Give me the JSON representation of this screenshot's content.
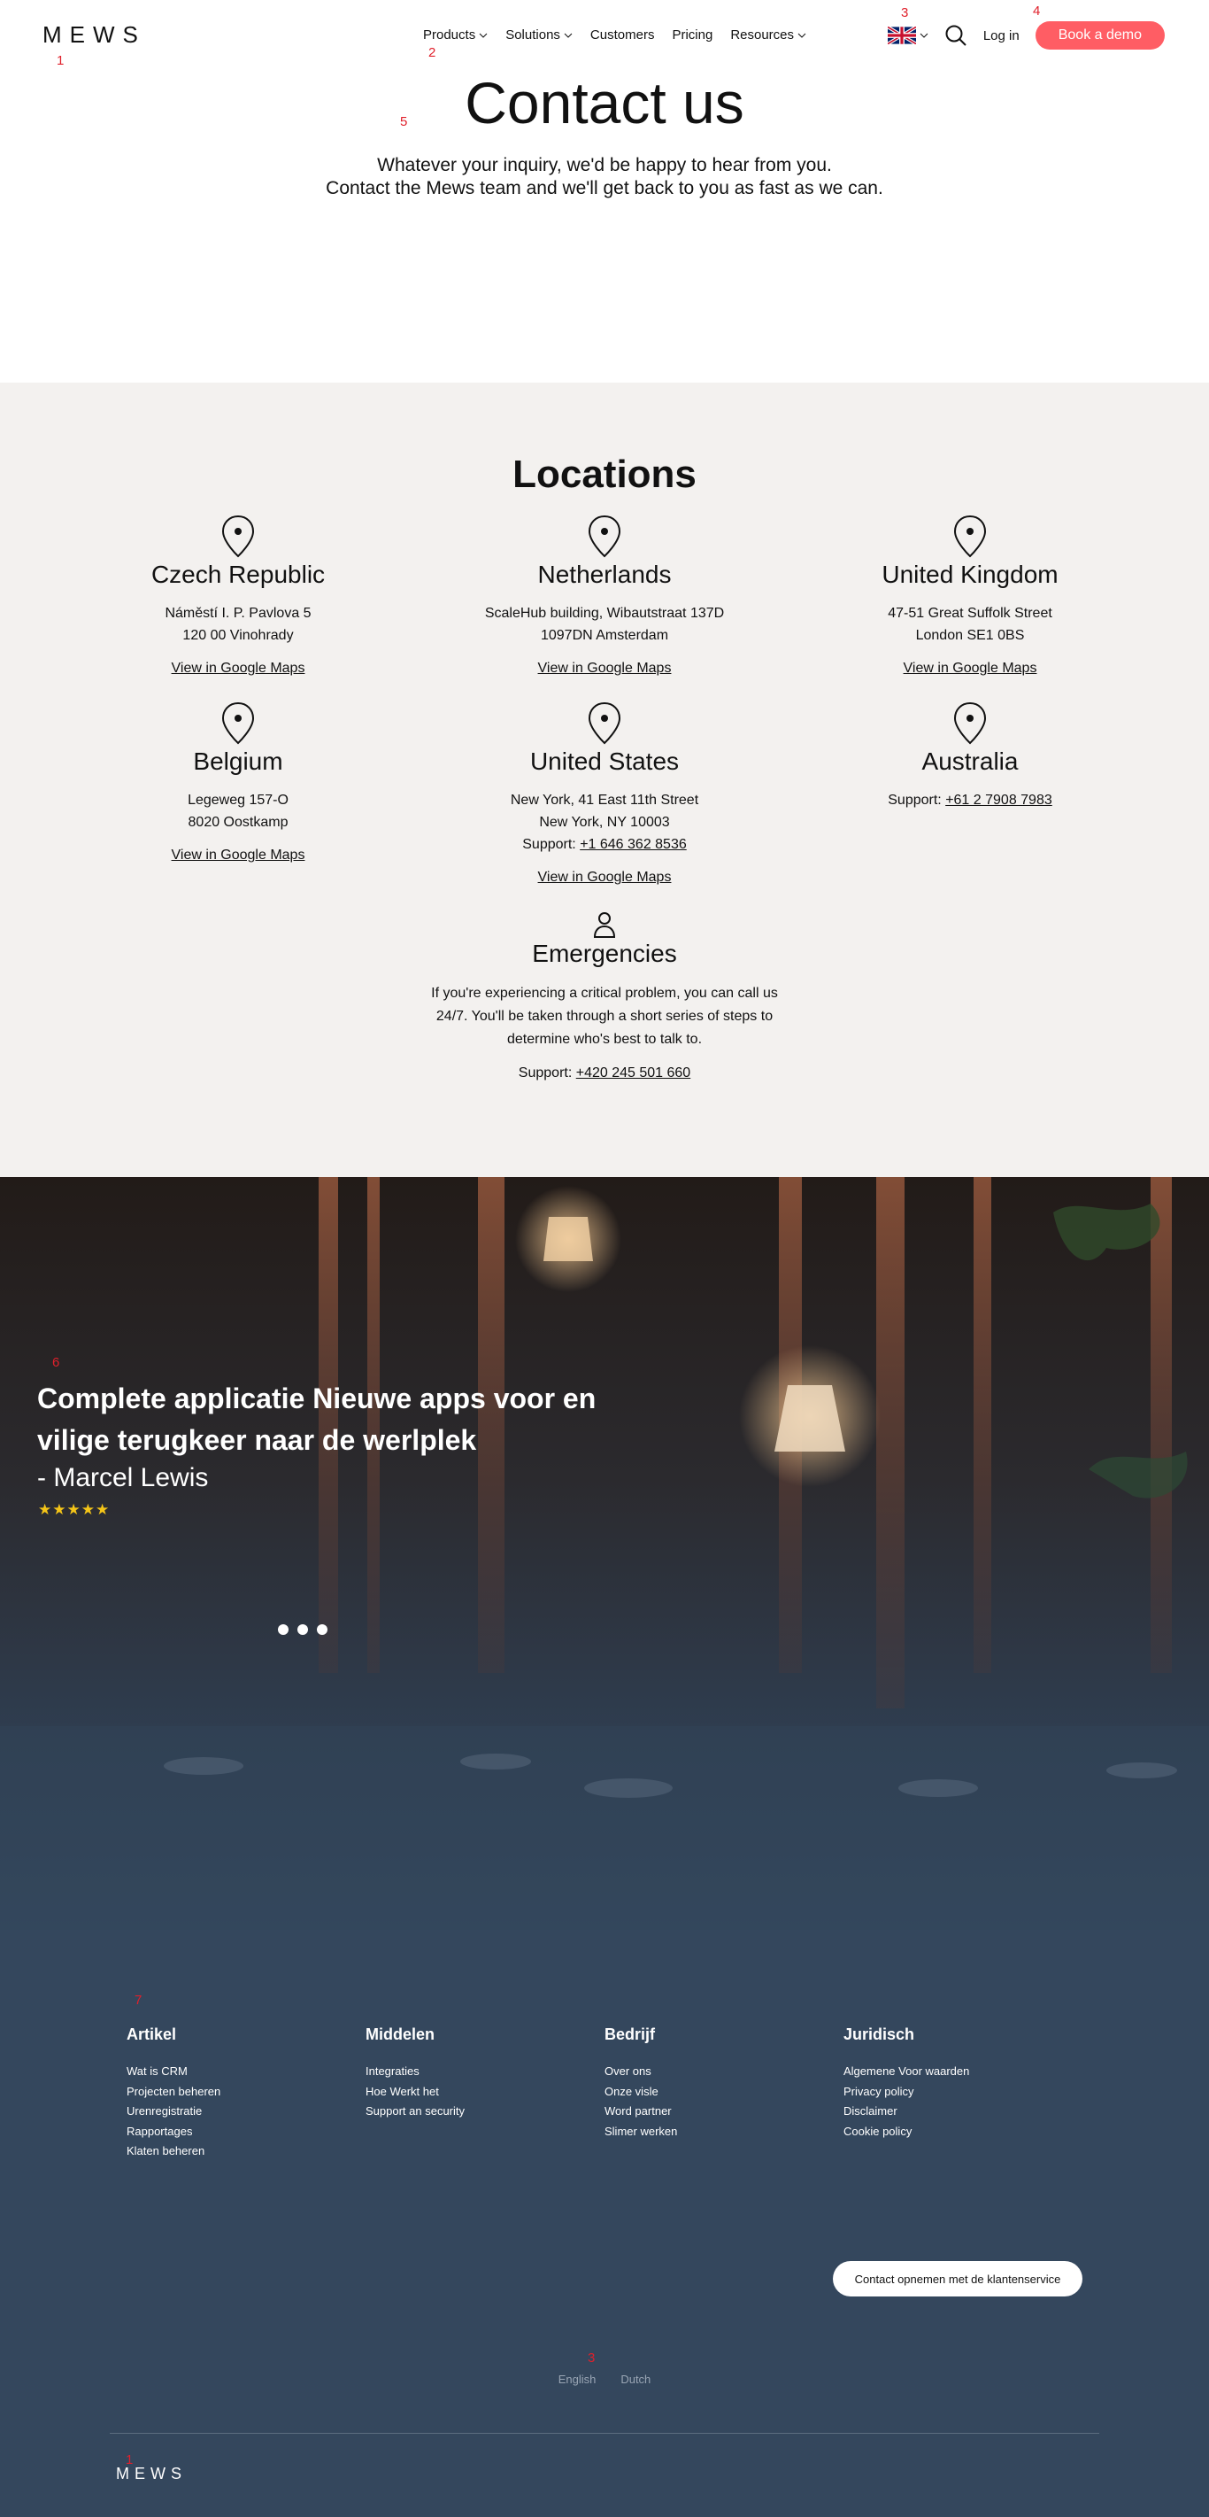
{
  "header": {
    "logo": "MEWS",
    "nav": [
      {
        "label": "Products",
        "dropdown": true
      },
      {
        "label": "Solutions",
        "dropdown": true
      },
      {
        "label": "Customers",
        "dropdown": false
      },
      {
        "label": "Pricing",
        "dropdown": false
      },
      {
        "label": "Resources",
        "dropdown": true
      }
    ],
    "language_flag_icon": "uk-flag-icon",
    "search_icon": "search-icon",
    "login_label": "Log in",
    "cta_label": "Book a demo",
    "cta_color": "#ff5d64"
  },
  "hero": {
    "title": "Contact us",
    "subtitle_line1": "Whatever your inquiry, we'd be happy to hear from you.",
    "subtitle_line2": "Contact the Mews team and we'll get back to you as fast as we can."
  },
  "locations": {
    "title": "Locations",
    "offices": [
      {
        "country": "Czech Republic",
        "address": [
          "Náměstí I. P. Pavlova 5",
          "120 00 Vinohrady"
        ],
        "maps_link": "View in Google Maps"
      },
      {
        "country": "Netherlands",
        "address": [
          "ScaleHub building, Wibautstraat 137D",
          "1097DN Amsterdam"
        ],
        "maps_link": "View in Google Maps"
      },
      {
        "country": "United Kingdom",
        "address": [
          "47-51 Great Suffolk Street",
          "London SE1 0BS"
        ],
        "maps_link": "View in Google Maps"
      },
      {
        "country": "Belgium",
        "address": [
          "Legeweg 157-O",
          "8020 Oostkamp"
        ],
        "maps_link": "View in Google Maps"
      },
      {
        "country": "United States",
        "address": [
          "New York, 41 East 11th Street",
          "New York, NY 10003"
        ],
        "support_label": "Support:",
        "support_phone": "+1 646 362 8536",
        "maps_link": "View in Google Maps"
      },
      {
        "country": "Australia",
        "support_label": "Support:",
        "support_phone": "+61 2 7908 7983"
      }
    ],
    "emergency": {
      "title": "Emergencies",
      "text": "If you're experiencing a critical problem, you can call us 24/7. You'll be taken through a short series of steps to determine who's best to talk to.",
      "support_label": "Support:",
      "support_phone": "+420 245 501 660"
    }
  },
  "testimonial": {
    "quote": "Complete applicatie Nieuwe apps voor en vilige terugkeer naar de werlplek",
    "author": "- Marcel Lewis",
    "rating": 5,
    "stars": "★★★★★",
    "slides": 3
  },
  "footer": {
    "columns": [
      {
        "heading": "Artikel",
        "links": [
          "Wat is CRM",
          "Projecten beheren",
          "Urenregistratie",
          "Rapportages",
          "Klaten beheren"
        ]
      },
      {
        "heading": "Middelen",
        "links": [
          "Integraties",
          "Hoe Werkt het",
          "Support an security"
        ]
      },
      {
        "heading": "Bedrijf",
        "links": [
          "Over ons",
          "Onze visle",
          "Word partner",
          "Slimer werken"
        ]
      },
      {
        "heading": "Juridisch",
        "links": [
          "Algemene Voor waarden",
          "Privacy policy",
          "Disclaimer",
          "Cookie policy"
        ]
      }
    ],
    "contact_button": "Contact opnemen met de klantenservice",
    "languages": [
      "English",
      "Dutch"
    ],
    "logo": "MEWS"
  },
  "markers": [
    "1",
    "2",
    "3",
    "4",
    "5",
    "6",
    "7",
    "3",
    "1"
  ]
}
